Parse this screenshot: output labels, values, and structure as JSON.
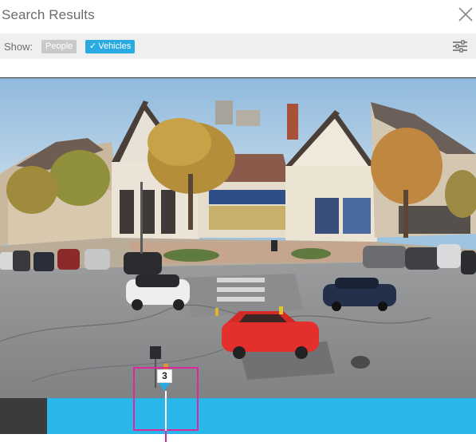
{
  "header": {
    "title": "Search Results",
    "close_icon": "close-icon"
  },
  "filters": {
    "show_label": "Show:",
    "people_label": "People",
    "vehicles_label": "Vehicles",
    "vehicles_checked": true,
    "people_checked": false,
    "settings_icon": "sliders-icon"
  },
  "timeline": {
    "marker_count": "3",
    "accent_color": "#29b6e8",
    "highlight_color": "#e0269b"
  }
}
